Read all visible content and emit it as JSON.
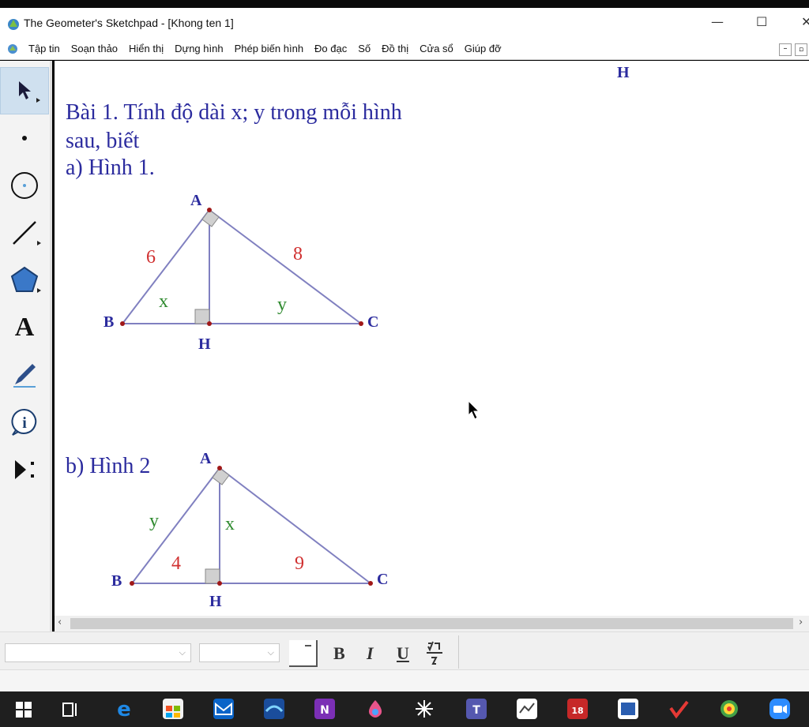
{
  "window": {
    "title": "The Geometer's Sketchpad - [Khong ten 1]",
    "minimize": "—",
    "maximize": "☐",
    "close": "✕"
  },
  "menu": [
    "Tập tin",
    "Soạn thảo",
    "Hiển thị",
    "Dựng hình",
    "Phép biến hình",
    "Đo đạc",
    "Số",
    "Đồ thị",
    "Cửa sổ",
    "Giúp đỡ"
  ],
  "canvas": {
    "top_label": "H",
    "problem_line1": "Bài 1. Tính độ dài x; y trong mỗi hình",
    "problem_line2": "sau, biết",
    "part_a": "a) Hình 1.",
    "part_b": "b) Hình 2",
    "figure1": {
      "vertices": {
        "A": "A",
        "B": "B",
        "C": "C",
        "H": "H"
      },
      "side_AB": "6",
      "side_AC": "8",
      "segment_BH": "x",
      "segment_HC": "y"
    },
    "figure2": {
      "vertices": {
        "A": "A",
        "B": "B",
        "C": "C",
        "H": "H"
      },
      "side_AB": "y",
      "altitude_AH": "x",
      "segment_BH": "4",
      "segment_HC": "9"
    }
  },
  "text_palette": {
    "bold": "B",
    "italic": "I",
    "underline": "U"
  },
  "colors": {
    "text_blue": "#2b2b9e",
    "given_red": "#d03030",
    "unknown_green": "#2f8a2f",
    "line_purple": "#8080c0",
    "point_red": "#a01818",
    "selected_tool": "#cfe0ef"
  },
  "tools": [
    "arrow-icon",
    "point-icon",
    "compass-icon",
    "straightedge-icon",
    "polygon-icon",
    "text-icon",
    "marker-icon",
    "information-icon",
    "custom-tool-icon"
  ],
  "taskbar": [
    "windows-start-icon",
    "task-view-icon",
    "edge-icon",
    "store-icon",
    "mail-icon",
    "onenote-icon",
    "paint-icon",
    "teams-icon",
    "whiteboard-icon",
    "calendar-icon",
    "zoom-icon"
  ]
}
